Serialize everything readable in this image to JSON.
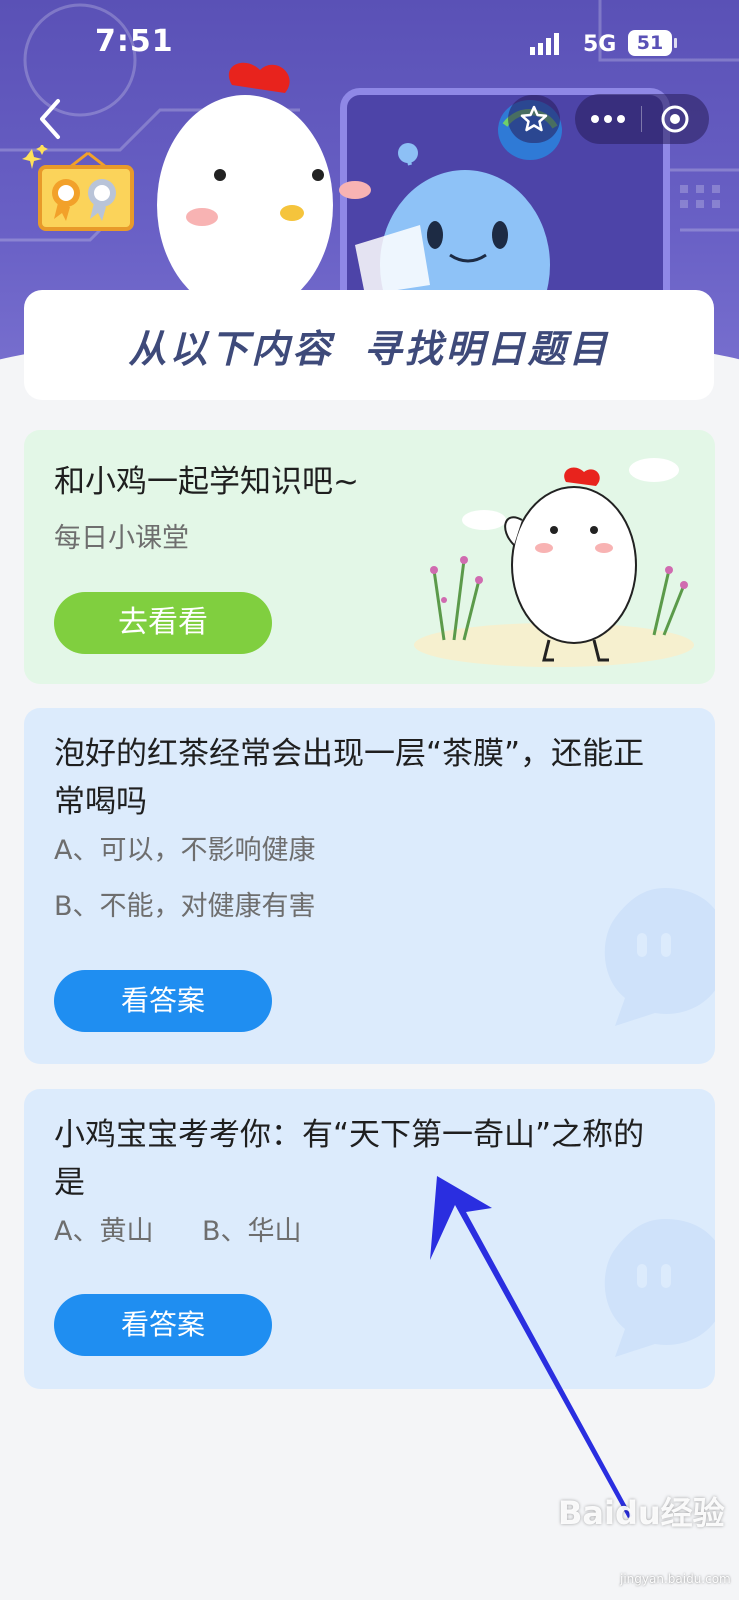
{
  "status_bar": {
    "time": "7:51",
    "network": "5G",
    "battery": "51"
  },
  "banner": {
    "title": "从以下内容  寻找明日题目"
  },
  "lesson_card": {
    "title": "和小鸡一起学知识吧~",
    "subtitle": "每日小课堂",
    "button_label": "去看看"
  },
  "questions": [
    {
      "question": "泡好的红茶经常会出现一层“茶膜”，还能正常喝吗",
      "options": [
        "A、可以，不影响健康",
        "B、不能，对健康有害"
      ],
      "button_label": "看答案"
    },
    {
      "question": "小鸡宝宝考考你：有“天下第一奇山”之称的是",
      "options": [
        "A、黄山",
        "B、华山"
      ],
      "button_label": "看答案"
    }
  ],
  "watermark": {
    "text": "Baidu经验",
    "url": "jingyan.baidu.com"
  },
  "colors": {
    "banner": "#5a51b6",
    "green_button": "#80cf3f",
    "blue_button": "#1f8ef1",
    "arrow": "#2a2ee0"
  },
  "icons": {
    "back": "chevron-left-icon",
    "favorite": "star-icon",
    "more": "more-dots-icon",
    "close": "target-close-icon"
  }
}
